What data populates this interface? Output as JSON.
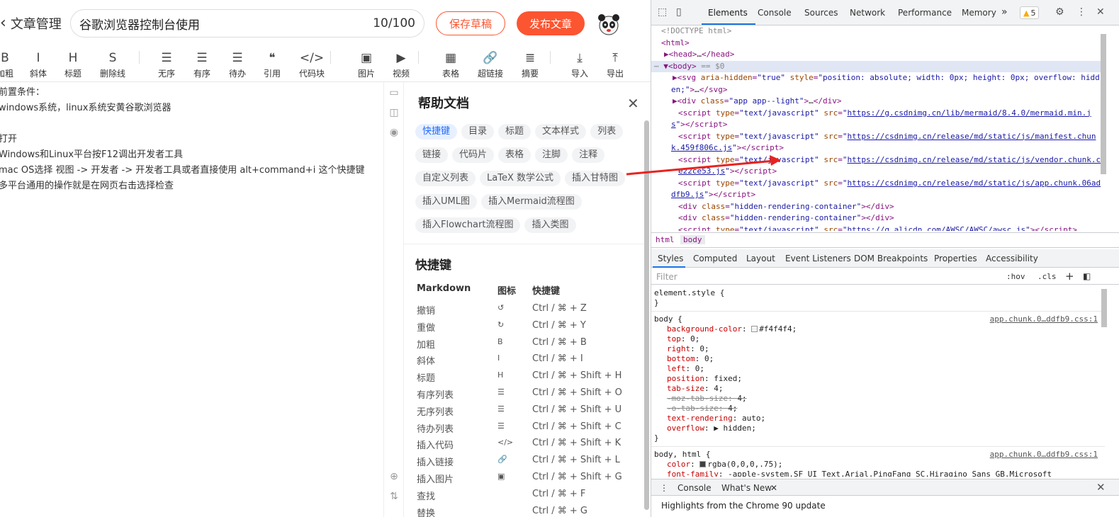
{
  "editor": {
    "back_label": "文章管理",
    "title_value": "谷歌浏览器控制台使用",
    "title_count": "10/100",
    "save_draft_label": "保存草稿",
    "publish_label": "发布文章",
    "toolbar": [
      {
        "icon": "bold-icon",
        "glyph": "B",
        "label": "加粗"
      },
      {
        "icon": "italic-icon",
        "glyph": "I",
        "label": "斜体"
      },
      {
        "icon": "heading-icon",
        "glyph": "H",
        "label": "标题"
      },
      {
        "icon": "strikethrough-icon",
        "glyph": "S",
        "label": "删除线"
      },
      {
        "icon": "unordered-list-icon",
        "glyph": "☰",
        "label": "无序"
      },
      {
        "icon": "ordered-list-icon",
        "glyph": "☰",
        "label": "有序"
      },
      {
        "icon": "todo-list-icon",
        "glyph": "☰",
        "label": "待办"
      },
      {
        "icon": "quote-icon",
        "glyph": "❝",
        "label": "引用"
      },
      {
        "icon": "code-icon",
        "glyph": "</>",
        "label": "代码块"
      },
      {
        "icon": "image-icon",
        "glyph": "▣",
        "label": "图片"
      },
      {
        "icon": "video-icon",
        "glyph": "▶",
        "label": "视频"
      },
      {
        "icon": "table-icon",
        "glyph": "▦",
        "label": "表格"
      },
      {
        "icon": "link-icon",
        "glyph": "🔗",
        "label": "超链接"
      },
      {
        "icon": "summary-icon",
        "glyph": "≣",
        "label": "摘要"
      },
      {
        "icon": "import-icon",
        "glyph": "⤓",
        "label": "导入"
      },
      {
        "icon": "export-icon",
        "glyph": "⤒",
        "label": "导出"
      }
    ],
    "content_lines": [
      "前置条件：",
      "windows系统，linux系统安黄谷歌浏览器",
      "",
      "打开",
      "Windows和Linux平台按F12调出开发者工具",
      "mac OS选择 视图 -> 开发者 -> 开发者工具或者直接使用 alt+command+i 这个快捷键",
      "多平台通用的操作就是在网页右击选择检查"
    ]
  },
  "help": {
    "title": "帮助文档",
    "tags": [
      {
        "label": "快捷键",
        "active": true
      },
      {
        "label": "目录"
      },
      {
        "label": "标题"
      },
      {
        "label": "文本样式"
      },
      {
        "label": "列表"
      },
      {
        "label": "链接"
      },
      {
        "label": "代码片"
      },
      {
        "label": "表格"
      },
      {
        "label": "注脚"
      },
      {
        "label": "注释"
      },
      {
        "label": "自定义列表"
      },
      {
        "label": "LaTeX 数学公式"
      },
      {
        "label": "插入甘特图"
      },
      {
        "label": "插入UML图"
      },
      {
        "label": "插入Mermaid流程图"
      },
      {
        "label": "插入Flowchart流程图"
      },
      {
        "label": "插入类图"
      }
    ],
    "shortcut_title": "快捷键",
    "columns": [
      "Markdown",
      "图标",
      "快捷键"
    ],
    "rows": [
      {
        "name": "撤销",
        "icon": "↺",
        "keys": "Ctrl / ⌘ + Z"
      },
      {
        "name": "重做",
        "icon": "↻",
        "keys": "Ctrl / ⌘ + Y"
      },
      {
        "name": "加粗",
        "icon": "B",
        "keys": "Ctrl / ⌘ + B"
      },
      {
        "name": "斜体",
        "icon": "I",
        "keys": "Ctrl / ⌘ + I"
      },
      {
        "name": "标题",
        "icon": "H",
        "keys": "Ctrl / ⌘ + Shift + H"
      },
      {
        "name": "有序列表",
        "icon": "☰",
        "keys": "Ctrl / ⌘ + Shift + O"
      },
      {
        "name": "无序列表",
        "icon": "☰",
        "keys": "Ctrl / ⌘ + Shift + U"
      },
      {
        "name": "待办列表",
        "icon": "☰",
        "keys": "Ctrl / ⌘ + Shift + C"
      },
      {
        "name": "插入代码",
        "icon": "</>",
        "keys": "Ctrl / ⌘ + Shift + K"
      },
      {
        "name": "插入链接",
        "icon": "🔗",
        "keys": "Ctrl / ⌘ + Shift + L"
      },
      {
        "name": "插入图片",
        "icon": "▣",
        "keys": "Ctrl / ⌘ + Shift + G"
      },
      {
        "name": "查找",
        "icon": "",
        "keys": "Ctrl / ⌘ + F"
      },
      {
        "name": "替换",
        "icon": "",
        "keys": "Ctrl / ⌘ + G"
      }
    ]
  },
  "devtools": {
    "tabs": [
      "Elements",
      "Console",
      "Sources",
      "Network",
      "Performance",
      "Memory"
    ],
    "more": "»",
    "warnings": "5",
    "dom_lines": [
      {
        "html": "<span class='gr'>&lt;!DOCTYPE html&gt;</span>"
      },
      {
        "html": "<span class='t'>&lt;html&gt;</span>"
      },
      {
        "html": "▶<span class='t'>&lt;head&gt;</span><span class='tx'>…</span><span class='t'>&lt;/head&gt;</span>"
      },
      {
        "html": "▼<span class='t'>&lt;body&gt;</span> <span class='gr'>== $0</span>",
        "selected": true
      },
      {
        "html": "▶<span class='t'>&lt;svg </span><span class='an'>aria-hidden</span>=<span class='av'>\"true\"</span> <span class='an'>style</span>=<span class='av'>\"position: absolute; width: 0px; height: 0px; overflow: hidd</span>"
      },
      {
        "html": "<span class='av'>en;\"</span><span class='t'>&gt;</span><span class='tx'>…</span><span class='t'>&lt;/svg&gt;</span>"
      },
      {
        "html": "▶<span class='t'>&lt;div </span><span class='an'>class</span>=<span class='av'>\"app app--light\"</span><span class='t'>&gt;</span><span class='tx'>…</span><span class='t'>&lt;/div&gt;</span>"
      },
      {
        "html": "<span class='t'>&lt;script </span><span class='an'>type</span>=<span class='av'>\"text/javascript\"</span> <span class='an'>src</span>=<span class='av'>\"</span><span class='lk'>https://g.csdnimg.cn/lib/mermaid/8.4.0/mermaid.min.j</span>"
      },
      {
        "html": "<span class='lk'>s</span><span class='av'>\"</span><span class='t'>&gt;&lt;/script&gt;</span>"
      },
      {
        "html": "<span class='t'>&lt;script </span><span class='an'>type</span>=<span class='av'>\"text/javascript\"</span> <span class='an'>src</span>=<span class='av'>\"</span><span class='lk'>https://csdnimg.cn/release/md/static/js/manifest.chun</span>"
      },
      {
        "html": "<span class='lk'>k.459f806c.js</span><span class='av'>\"</span><span class='t'>&gt;&lt;/script&gt;</span>"
      },
      {
        "html": "<span class='t'>&lt;script </span><span class='an'>type</span>=<span class='av'>\"text/javascript\"</span> <span class='an'>src</span>=<span class='av'>\"</span><span class='lk'>https://csdnimg.cn/release/md/static/js/vendor.chunk.c</span>"
      },
      {
        "html": "<span class='lk'>e22ce53.js</span><span class='av'>\"</span><span class='t'>&gt;&lt;/script&gt;</span>"
      },
      {
        "html": "<span class='t'>&lt;script </span><span class='an'>type</span>=<span class='av'>\"text/javascript\"</span> <span class='an'>src</span>=<span class='av'>\"</span><span class='lk'>https://csdnimg.cn/release/md/static/js/app.chunk.06ad</span>"
      },
      {
        "html": "<span class='lk'>dfb9.js</span><span class='av'>\"</span><span class='t'>&gt;&lt;/script&gt;</span>"
      },
      {
        "html": "<span class='t'>&lt;div </span><span class='an'>class</span>=<span class='av'>\"hidden-rendering-container\"</span><span class='t'>&gt;&lt;/div&gt;</span>"
      },
      {
        "html": "<span class='t'>&lt;div </span><span class='an'>class</span>=<span class='av'>\"hidden-rendering-container\"</span><span class='t'>&gt;&lt;/div&gt;</span>"
      },
      {
        "html": "<span class='t'>&lt;script </span><span class='an'>type</span>=<span class='av'>\"text/javascript\"</span> <span class='an'>src</span>=<span class='av'>\"</span><span class='lk'>https://g.alicdn.com/AWSC/AWSC/awsc.js</span><span class='av'>\"</span><span class='t'>&gt;&lt;/script&gt;</span>"
      }
    ],
    "crumbs": [
      "html",
      "body"
    ],
    "sub_tabs": [
      "Styles",
      "Computed",
      "Layout",
      "Event Listeners",
      "DOM Breakpoints",
      "Properties",
      "Accessibility"
    ],
    "filter_placeholder": "Filter",
    "hov": ":hov",
    "cls": ".cls",
    "rules": [
      {
        "selector": "element.style {",
        "src": "",
        "props": []
      },
      {
        "selector": "body {",
        "src": "app.chunk.0…ddfb9.css:1",
        "props": [
          {
            "n": "background-color",
            "v": "#f4f4f4;",
            "swatch": "#f4f4f4"
          },
          {
            "n": "top",
            "v": "0;"
          },
          {
            "n": "right",
            "v": "0;"
          },
          {
            "n": "bottom",
            "v": "0;"
          },
          {
            "n": "left",
            "v": "0;"
          },
          {
            "n": "position",
            "v": "fixed;"
          },
          {
            "n": "tab-size",
            "v": "4;"
          },
          {
            "n": "-moz-tab-size",
            "v": "4;",
            "struck": true
          },
          {
            "n": "-o-tab-size",
            "v": "4;",
            "struck": true
          },
          {
            "n": "text-rendering",
            "v": "auto;"
          },
          {
            "n": "overflow",
            "v": "▶ hidden;"
          }
        ]
      },
      {
        "selector": "body, html {",
        "src": "app.chunk.0…ddfb9.css:1",
        "props": [
          {
            "n": "color",
            "v": "rgba(0,0,0,.75);",
            "swatch": "#404040"
          },
          {
            "n": "font-family",
            "v": "-apple-system,SF UI Text,Arial,PingFang SC,Hiragino Sans GB,Microsoft"
          }
        ]
      }
    ],
    "drawer_tabs": [
      "Console",
      "What's New"
    ],
    "whats_new": "Highlights from the Chrome 90 update"
  },
  "colors": {
    "accent": "#fc5531",
    "devtools_blue": "#1a73e8",
    "annotation_arrow": "#e8231f"
  }
}
